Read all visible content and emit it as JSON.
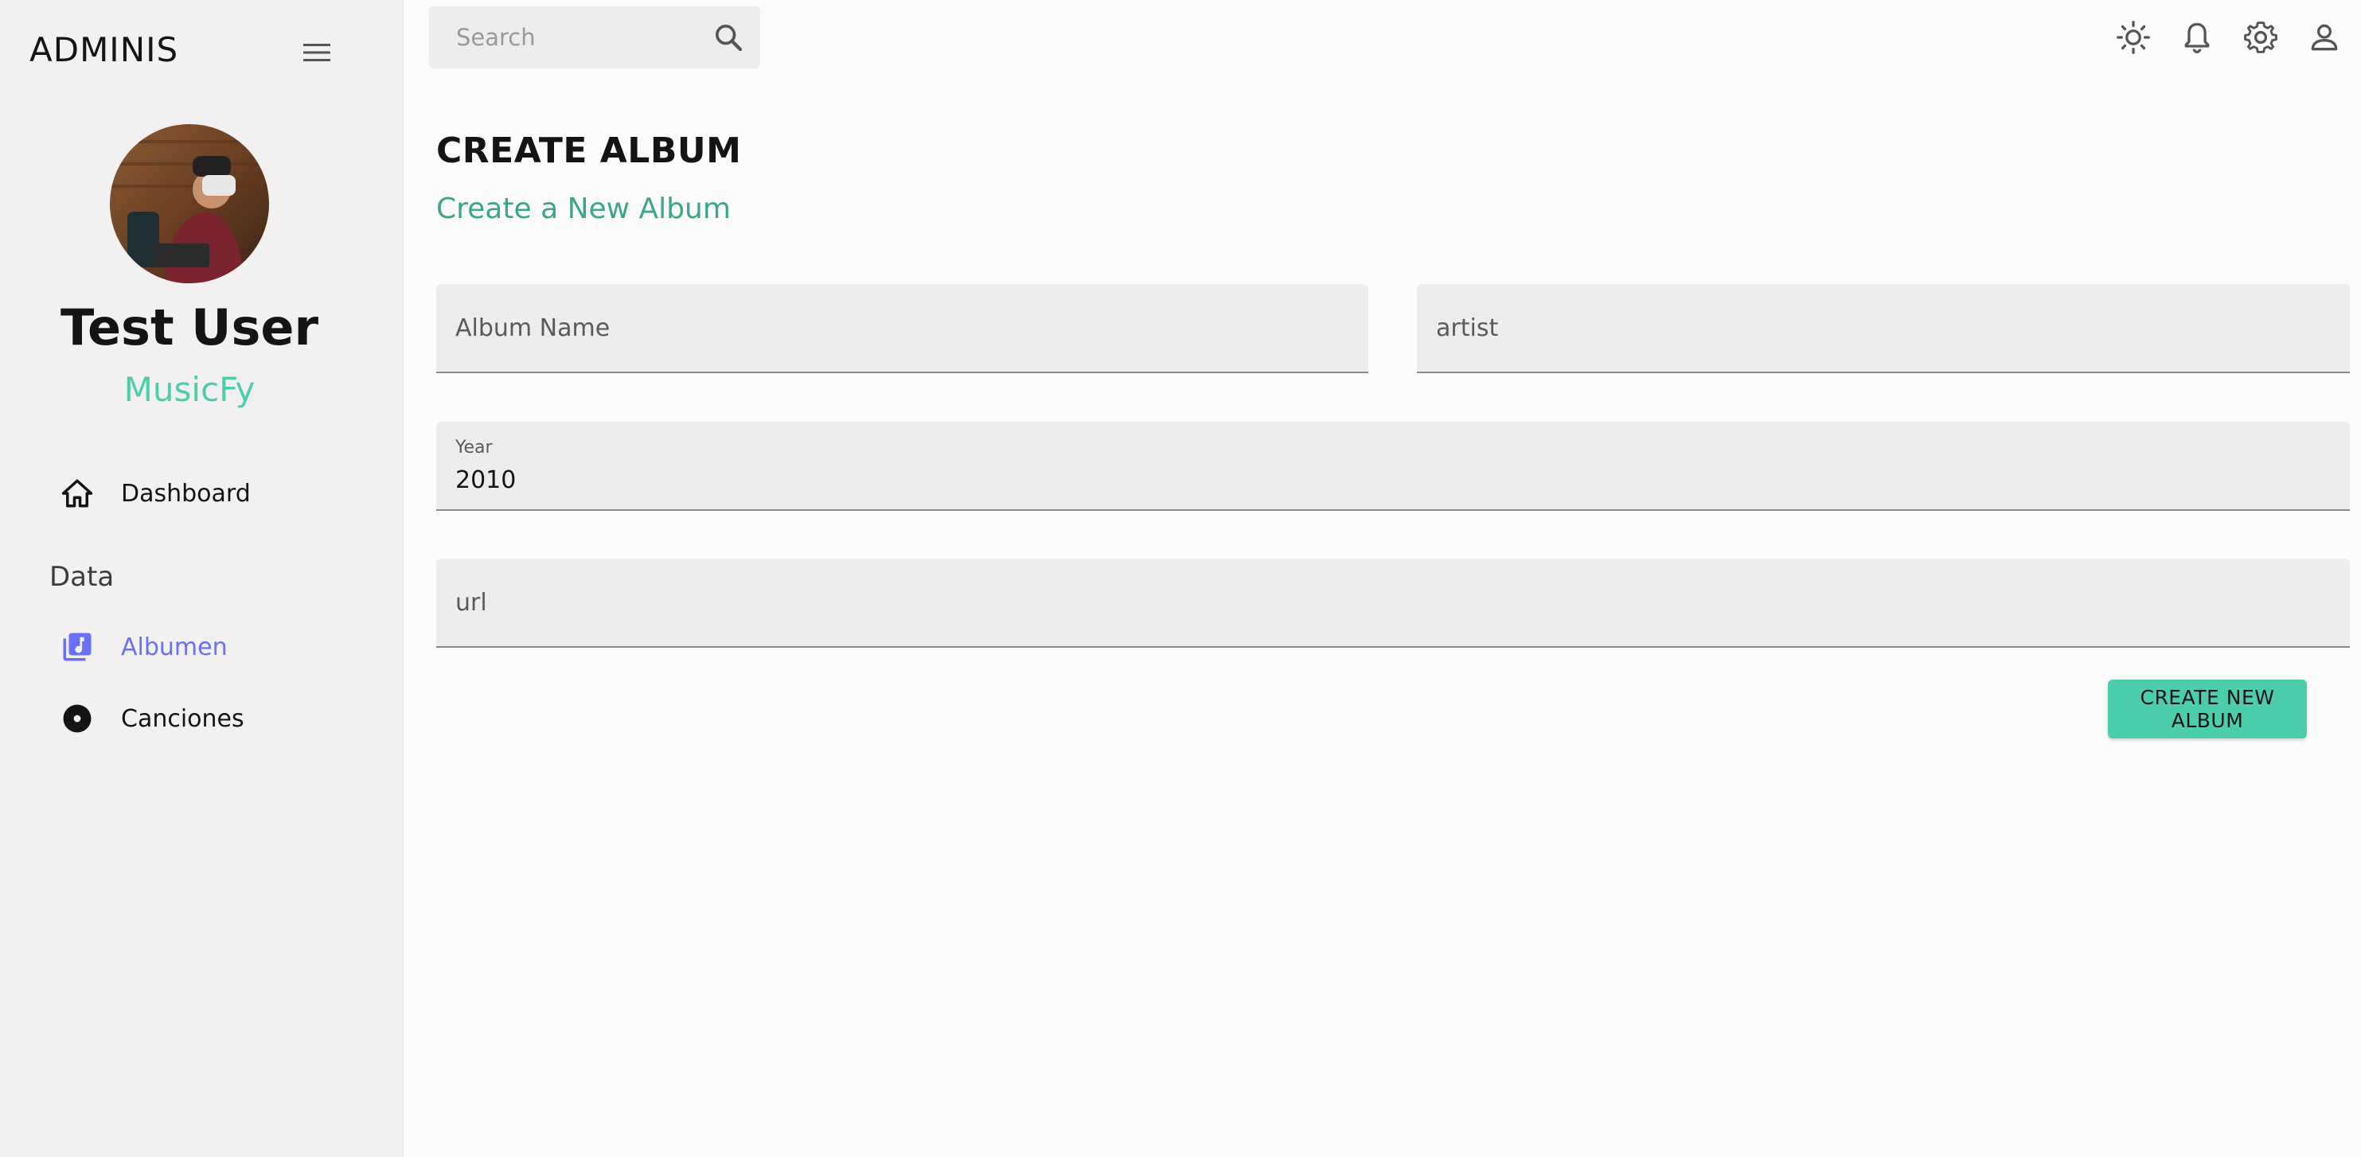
{
  "app": {
    "brand": "ADMINIS"
  },
  "sidebar": {
    "profile": {
      "name": "Test User",
      "role": "MusicFy"
    },
    "items": [
      {
        "label": "Dashboard",
        "icon": "home-icon"
      },
      {
        "label": "Albumen",
        "icon": "library-music-icon",
        "active": true
      },
      {
        "label": "Canciones",
        "icon": "album-disc-icon"
      }
    ],
    "section_label": "Data",
    "accent_color": "#4cceac",
    "active_color": "#6870fa"
  },
  "topbar": {
    "search_placeholder": "Search",
    "icons": [
      "light-mode-icon",
      "notifications-icon",
      "settings-icon",
      "person-icon"
    ]
  },
  "main": {
    "title": "CREATE ALBUM",
    "subtitle": "Create a New Album",
    "form": {
      "album_name_placeholder": "Album Name",
      "artist_placeholder": "artist",
      "year_label": "Year",
      "year_value": "2010",
      "url_placeholder": "url",
      "submit_label": "CREATE NEW ALBUM"
    }
  }
}
